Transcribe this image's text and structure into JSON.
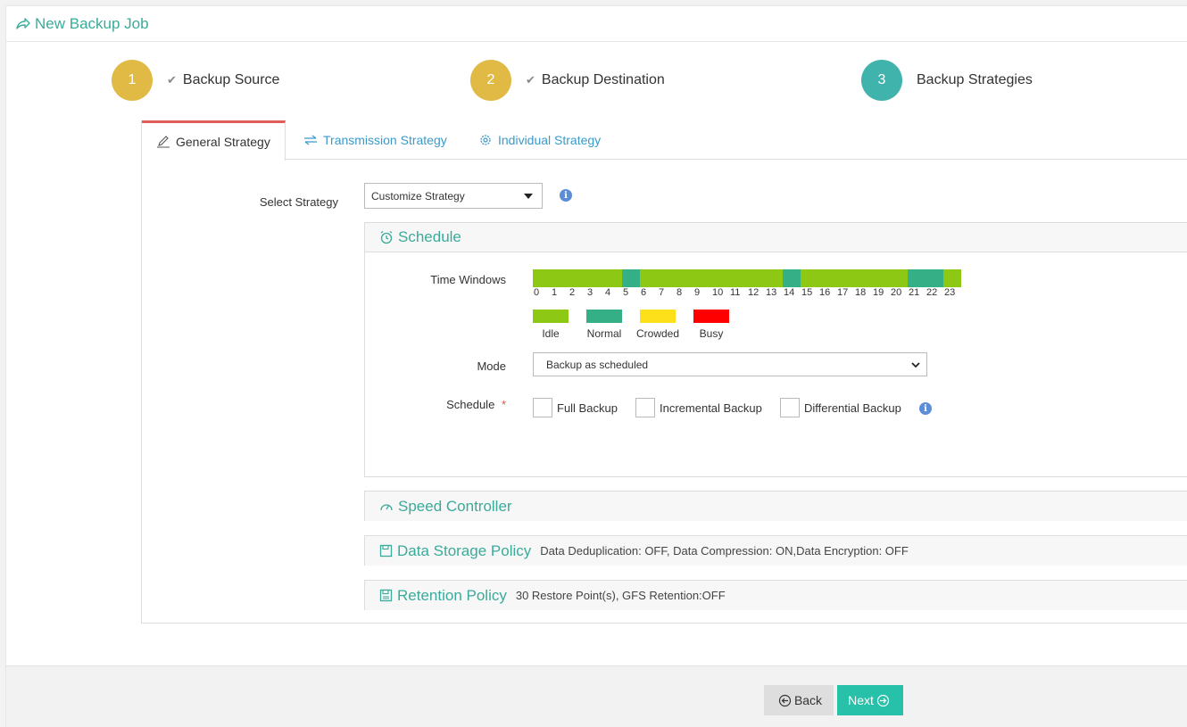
{
  "header": {
    "title": "New Backup Job"
  },
  "steps": [
    {
      "number": "1",
      "label": "Backup Source",
      "done": true
    },
    {
      "number": "2",
      "label": "Backup Destination",
      "done": true
    },
    {
      "number": "3",
      "label": "Backup Strategies",
      "done": false
    }
  ],
  "tabs": [
    {
      "label": "General Strategy",
      "active": true
    },
    {
      "label": "Transmission Strategy",
      "active": false
    },
    {
      "label": "Individual Strategy",
      "active": false
    }
  ],
  "strategy": {
    "label": "Select Strategy",
    "value": "Customize Strategy"
  },
  "schedule_section": {
    "title": "Schedule",
    "time_windows_label": "Time Windows",
    "hours": [
      "0",
      "1",
      "2",
      "3",
      "4",
      "5",
      "6",
      "7",
      "8",
      "9",
      "10",
      "11",
      "12",
      "13",
      "14",
      "15",
      "16",
      "17",
      "18",
      "19",
      "20",
      "21",
      "22",
      "23"
    ],
    "hour_states": [
      "idle",
      "idle",
      "idle",
      "idle",
      "idle",
      "normal",
      "idle",
      "idle",
      "idle",
      "idle",
      "idle",
      "idle",
      "idle",
      "idle",
      "normal",
      "idle",
      "idle",
      "idle",
      "idle",
      "idle",
      "idle",
      "normal",
      "normal",
      "idle"
    ],
    "legend": [
      {
        "label": "Idle",
        "color": "#8cc814"
      },
      {
        "label": "Normal",
        "color": "#35b086"
      },
      {
        "label": "Crowded",
        "color": "#fde01a"
      },
      {
        "label": "Busy",
        "color": "#fe0000"
      }
    ],
    "mode_label": "Mode",
    "mode_value": "Backup as scheduled",
    "schedule_label": "Schedule",
    "required_mark": "*",
    "options": [
      "Full Backup",
      "Incremental Backup",
      "Differential Backup"
    ]
  },
  "speed_section": {
    "title": "Speed Controller"
  },
  "storage_section": {
    "title": "Data Storage Policy",
    "summary": "Data Deduplication: OFF, Data Compression: ON,Data Encryption: OFF"
  },
  "retention_section": {
    "title": "Retention Policy",
    "summary": "30 Restore Point(s), GFS Retention:OFF"
  },
  "footer": {
    "back_label": "Back",
    "next_label": "Next"
  },
  "colors": {
    "accent": "#3aab9a",
    "step_done": "#e0ba45",
    "step_active": "#3fb3ac",
    "next_button": "#27c0a8",
    "tab_active_border": "#e35b5b"
  }
}
